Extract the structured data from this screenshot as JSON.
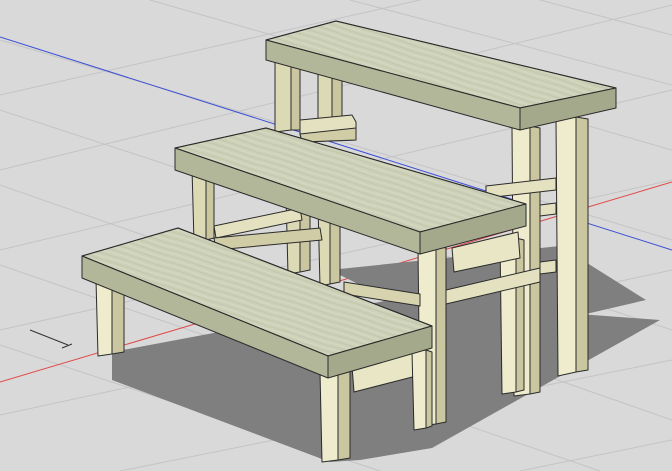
{
  "scene": {
    "subject": "",
    "colors": {
      "background": "#d9d9d9",
      "grid": "#c4c4c4",
      "axis_red": "#e04848",
      "axis_blue": "#3a4fd6",
      "shadow": "#7f7f7f",
      "wood_top": "#cdd1b7",
      "wood_front": "#b3b799",
      "wood_side": "#a5a98b",
      "leg_light": "#eeeccc",
      "leg_mid": "#dcdab5",
      "leg_dark": "#c9c6a0",
      "edge": "#2b2b2b"
    }
  }
}
